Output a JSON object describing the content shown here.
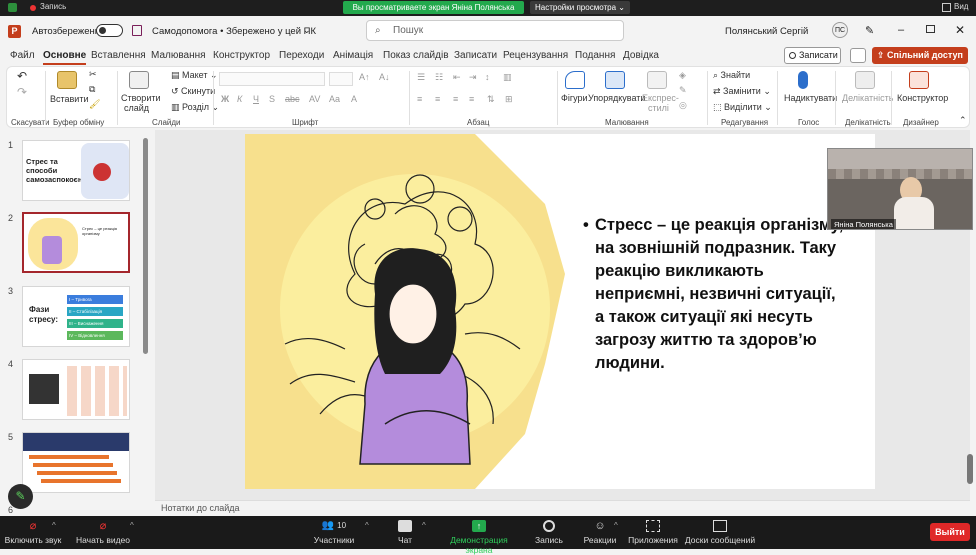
{
  "zoom_top": {
    "recording": "Запись",
    "banner": "Вы просматриваете экран Яніна Полянська",
    "view_settings": "Настройки просмотра",
    "view_label": "Вид"
  },
  "titlebar": {
    "autosave": "Автозбереження",
    "filename": "Самодопомога • Збережено у цей ПК",
    "search_placeholder": "Пошук",
    "user": "Полянський Сергій",
    "user_initials": "ПС"
  },
  "tabs": [
    "Файл",
    "Основне",
    "Вставлення",
    "Малювання",
    "Конструктор",
    "Переходи",
    "Анімація",
    "Показ слайдів",
    "Записати",
    "Рецензування",
    "Подання",
    "Довідка"
  ],
  "tab_actions": {
    "record": "Записати",
    "share": "Спільний доступ"
  },
  "ribbon": {
    "undo_group": "Скасувати",
    "clipboard": {
      "paste": "Вставити",
      "label": "Буфер обміну"
    },
    "slides": {
      "new_slide_1": "Створити",
      "new_slide_2": "слайд",
      "layout": "Макет",
      "reset": "Скинути",
      "section": "Розділ",
      "label": "Слайди"
    },
    "font": {
      "label": "Шрифт"
    },
    "paragraph": {
      "label": "Абзац"
    },
    "drawing": {
      "shapes": "Фігури",
      "arrange": "Упорядкувати",
      "quick_styles_1": "Експрес-",
      "quick_styles_2": "стилі",
      "label": "Малювання"
    },
    "editing": {
      "find": "Знайти",
      "replace": "Замінити",
      "select": "Виділити",
      "label": "Редагування"
    },
    "voice": {
      "dictate": "Надиктувати",
      "label": "Голос"
    },
    "sensitivity": {
      "btn": "Делікатність",
      "label": "Делікатність"
    },
    "designer": {
      "btn": "Конструктор",
      "label": "Дизайнер"
    }
  },
  "thumbnails": [
    {
      "num": "1",
      "text": "Стрес та способи самозаспокоєння"
    },
    {
      "num": "2",
      "text": "Стрес – це реакція організму"
    },
    {
      "num": "3",
      "text": "Фази стресу:",
      "phases": [
        "I – Тривога",
        "II – Стабілізація",
        "III – Виснаження",
        "IV – Відновлення"
      ]
    },
    {
      "num": "4",
      "text": ""
    },
    {
      "num": "5",
      "text": ""
    },
    {
      "num": "6",
      "text": ""
    }
  ],
  "slide": {
    "text": "Стресс – це реакція організму, на зовнішній подразник. Таку реакцію викликають неприємні, незвичні ситуації, а також ситуації які несуть загрозу життю та здоров’ю людини."
  },
  "notes": "Нотатки до слайда",
  "video": {
    "name": "Яніна Полянська"
  },
  "zoombar": {
    "mute": "Включить звук",
    "video": "Начать видео",
    "participants": "Участники",
    "participants_count": "10",
    "chat": "Чат",
    "share": "Демонстрация экрана",
    "record": "Запись",
    "reactions": "Реакции",
    "apps": "Приложения",
    "whiteboards": "Доски сообщений",
    "leave": "Выйти"
  },
  "colors": {
    "accent": "#c43e1c",
    "share_green": "#23a94d",
    "leave_red": "#e02828"
  }
}
